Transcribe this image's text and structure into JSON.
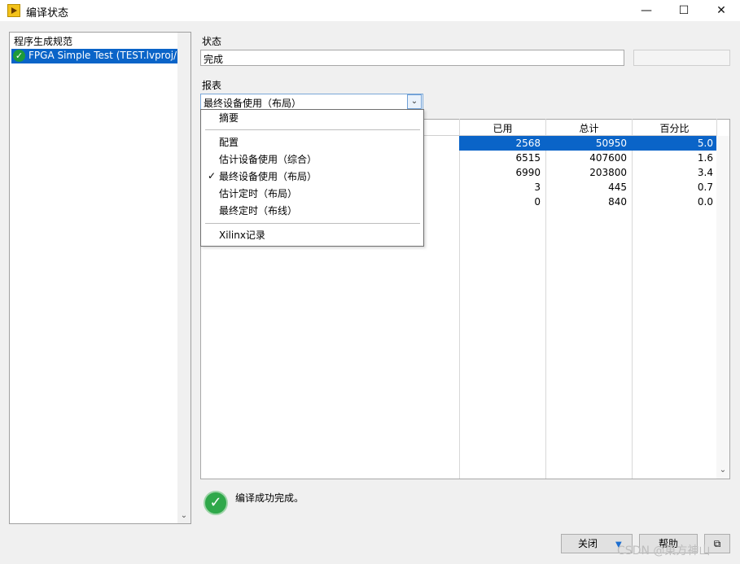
{
  "window": {
    "title": "编译状态",
    "minimize": "—",
    "maximize": "☐",
    "close": "✕"
  },
  "left": {
    "header": "程序生成规范",
    "items": [
      {
        "label": "FPGA Simple Test (TEST.lvproj/F",
        "status_icon": "check-circle-icon"
      }
    ]
  },
  "status": {
    "label": "状态",
    "value": "完成"
  },
  "report": {
    "label": "报表",
    "selected": "最终设备使用（布局）",
    "menu": {
      "items": [
        "摘要",
        "配置",
        "估计设备使用（综合）",
        "最终设备使用（布局）",
        "估计定时（布局）",
        "最终定时（布线）",
        "Xilinx记录"
      ],
      "checked": "最终设备使用（布局）",
      "check_mark": "✓"
    }
  },
  "table": {
    "headers": [
      "已用",
      "总计",
      "百分比"
    ],
    "rows": [
      [
        "2568",
        "50950",
        "5.0"
      ],
      [
        "6515",
        "407600",
        "1.6"
      ],
      [
        "6990",
        "203800",
        "3.4"
      ],
      [
        "3",
        "445",
        "0.7"
      ],
      [
        "0",
        "840",
        "0.0"
      ]
    ],
    "selected_row": 0
  },
  "footer": {
    "message": "编译成功完成。",
    "buttons": {
      "close": "关闭",
      "help": "帮助"
    }
  },
  "watermark": "CSDN @東方神山",
  "colors": {
    "selection": "#0a64c8",
    "success": "#2fa84a"
  }
}
